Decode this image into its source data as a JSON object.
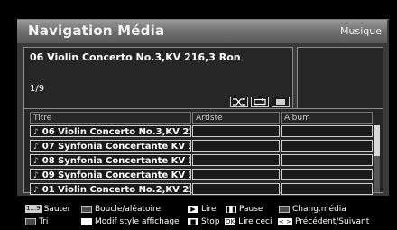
{
  "header": {
    "title": "Navigation Média",
    "mode": "Musique"
  },
  "now_playing": {
    "title": "06 Violin Concerto No.3,KV 216,3 Ron",
    "counter": "1/9"
  },
  "controls": [
    {
      "icon": "shuffle-icon"
    },
    {
      "icon": "repeat-icon"
    },
    {
      "icon": "stop-icon"
    }
  ],
  "table": {
    "columns": [
      "Titre",
      "Artiste",
      "Album"
    ],
    "rows": [
      {
        "title": "06 Violin Concerto No.3,KV 21..",
        "artist": "",
        "album": ""
      },
      {
        "title": "07 Synfonia Concertante KV 3...",
        "artist": "",
        "album": ""
      },
      {
        "title": "08 Synfonia Concertante KV 3...",
        "artist": "",
        "album": ""
      },
      {
        "title": "09 Synfonia Concertante KV 3...",
        "artist": "",
        "album": ""
      },
      {
        "title": "01 Violin Concerto No.2,KV 21..",
        "artist": "",
        "album": ""
      }
    ]
  },
  "legend": {
    "num_key": "1...9",
    "sauter": "Sauter",
    "boucle": "Boucle/aléatoire",
    "lire": "Lire",
    "pause": "Pause",
    "chang": "Chang.média",
    "tri": "Tri",
    "modif": "Modif style affichage",
    "stop": "Stop",
    "ok_key": "OK",
    "lire_ceci": "Lire ceci",
    "nav_key": "< >",
    "prec_suiv": "Précédent/Suivant"
  },
  "colors": {
    "title_bar": "#7a7a7a",
    "panel": "#262626",
    "frame": "#3a3a3a"
  }
}
